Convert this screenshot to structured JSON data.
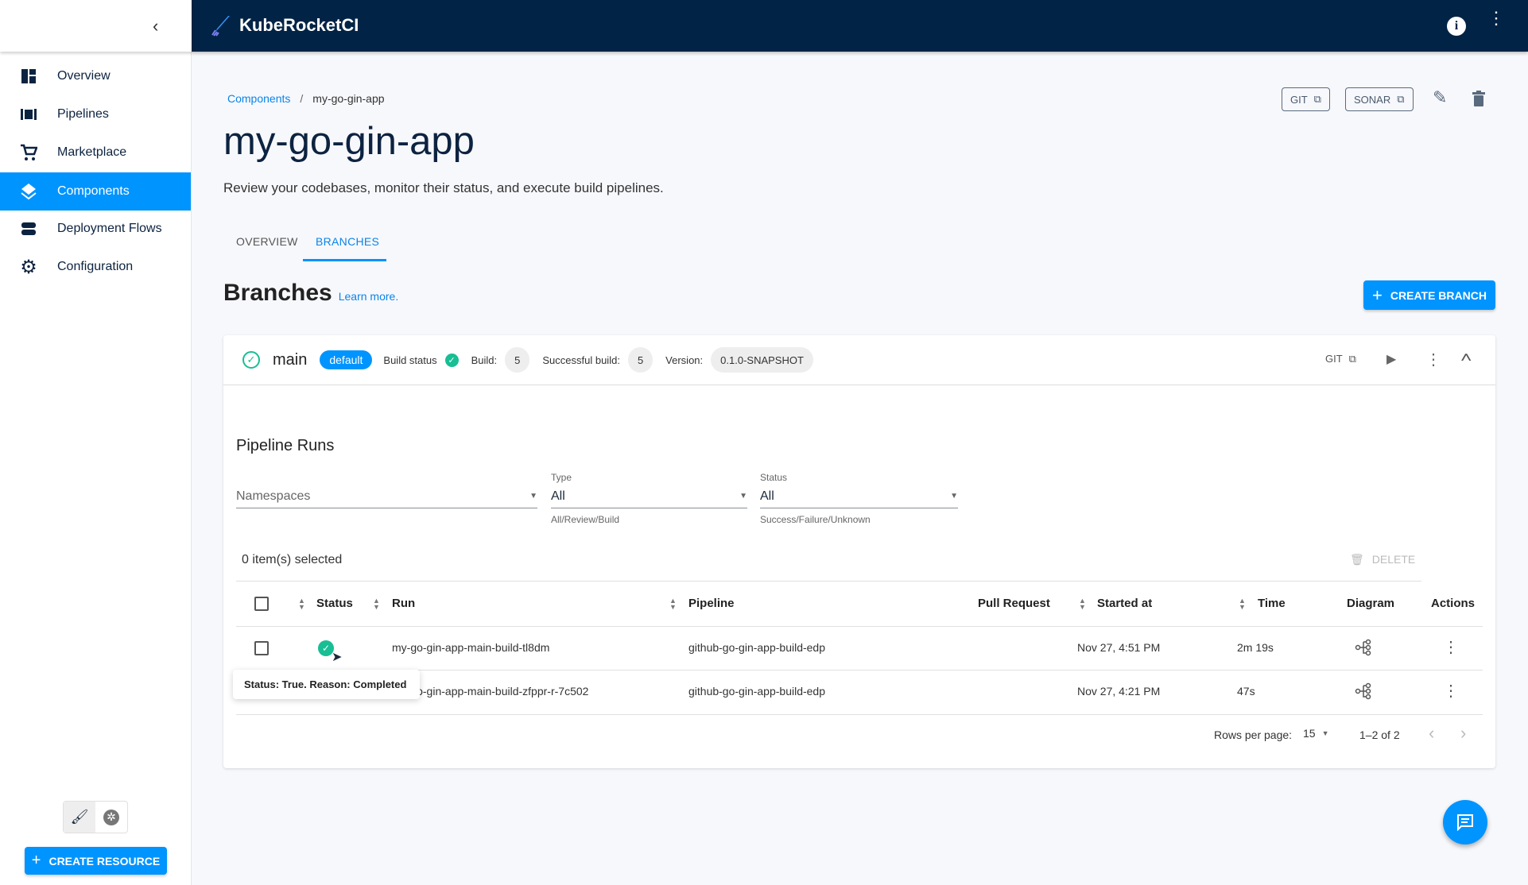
{
  "app": {
    "title": "KubeRocketCI",
    "colors": {
      "header": "#012345",
      "accent": "#0094ff",
      "success": "#18be94"
    }
  },
  "sidebar": {
    "collapse_icon": "chevron-left-icon",
    "items": [
      {
        "label": "Overview",
        "icon": "dashboard-icon"
      },
      {
        "label": "Pipelines",
        "icon": "pipelines-icon"
      },
      {
        "label": "Marketplace",
        "icon": "cart-icon"
      },
      {
        "label": "Components",
        "icon": "layers-icon",
        "active": true
      },
      {
        "label": "Deployment Flows",
        "icon": "flows-icon"
      },
      {
        "label": "Configuration",
        "icon": "gear-icon"
      }
    ],
    "create_resource": "CREATE RESOURCE"
  },
  "breadcrumb": {
    "parent": "Components",
    "separator": "/",
    "current": "my-go-gin-app"
  },
  "page": {
    "title": "my-go-gin-app",
    "subtitle": "Review your codebases, monitor their status, and execute build pipelines.",
    "git_button": "GIT",
    "sonar_button": "SONAR"
  },
  "tabs": [
    {
      "label": "OVERVIEW"
    },
    {
      "label": "BRANCHES",
      "active": true
    }
  ],
  "branches": {
    "title": "Branches",
    "learn_more": "Learn more.",
    "create_button": "CREATE BRANCH"
  },
  "branch": {
    "name": "main",
    "badge": "default",
    "build_status_label": "Build status",
    "build_label": "Build:",
    "build_value": "5",
    "successful_label": "Successful build:",
    "successful_value": "5",
    "version_label": "Version:",
    "version_value": "0.1.0-SNAPSHOT",
    "git_button": "GIT"
  },
  "runs": {
    "title": "Pipeline Runs",
    "filters": {
      "namespaces_placeholder": "Namespaces",
      "type_label": "Type",
      "type_value": "All",
      "type_helper": "All/Review/Build",
      "status_label": "Status",
      "status_value": "All",
      "status_helper": "Success/Failure/Unknown"
    },
    "selected": "0 item(s) selected",
    "delete": "DELETE",
    "columns": [
      "Status",
      "Run",
      "Pipeline",
      "Pull Request",
      "Started at",
      "Time",
      "Diagram",
      "Actions"
    ],
    "rows": [
      {
        "status": "success",
        "run": "my-go-gin-app-main-build-tl8dm",
        "pipeline": "github-go-gin-app-build-edp",
        "pull_request": "",
        "started": "Nov 27, 4:51 PM",
        "time": "2m 19s"
      },
      {
        "status": "success",
        "run": "my-go-gin-app-main-build-zfppr-r-7c502",
        "pipeline": "github-go-gin-app-build-edp",
        "pull_request": "",
        "started": "Nov 27, 4:21 PM",
        "time": "47s"
      }
    ],
    "tooltip": "Status: True. Reason: Completed",
    "pagination": {
      "rows_label": "Rows per page:",
      "rows_value": "15",
      "range": "1–2 of 2"
    }
  }
}
